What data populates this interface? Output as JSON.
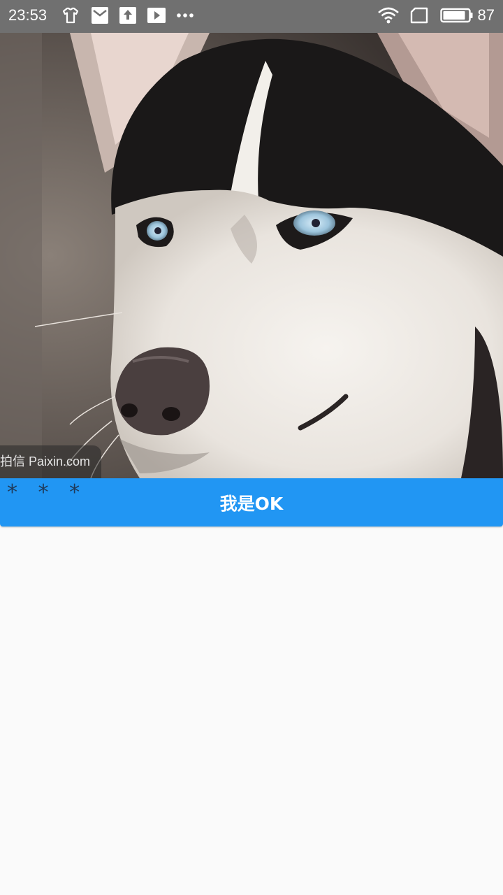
{
  "status_bar": {
    "time": "23:53",
    "battery_level": "87",
    "icons": [
      "tshirt-icon",
      "mail-icon",
      "upload-icon",
      "play-icon",
      "more-dots-icon",
      "wifi-icon",
      "sim-icon",
      "battery-icon"
    ],
    "background_color": "#707070"
  },
  "image": {
    "watermark": "拍信 Paixin.com"
  },
  "stars_text": "* * *",
  "button": {
    "label": "我是OK",
    "color": "#2196f3"
  },
  "page_background": "#fafafa"
}
